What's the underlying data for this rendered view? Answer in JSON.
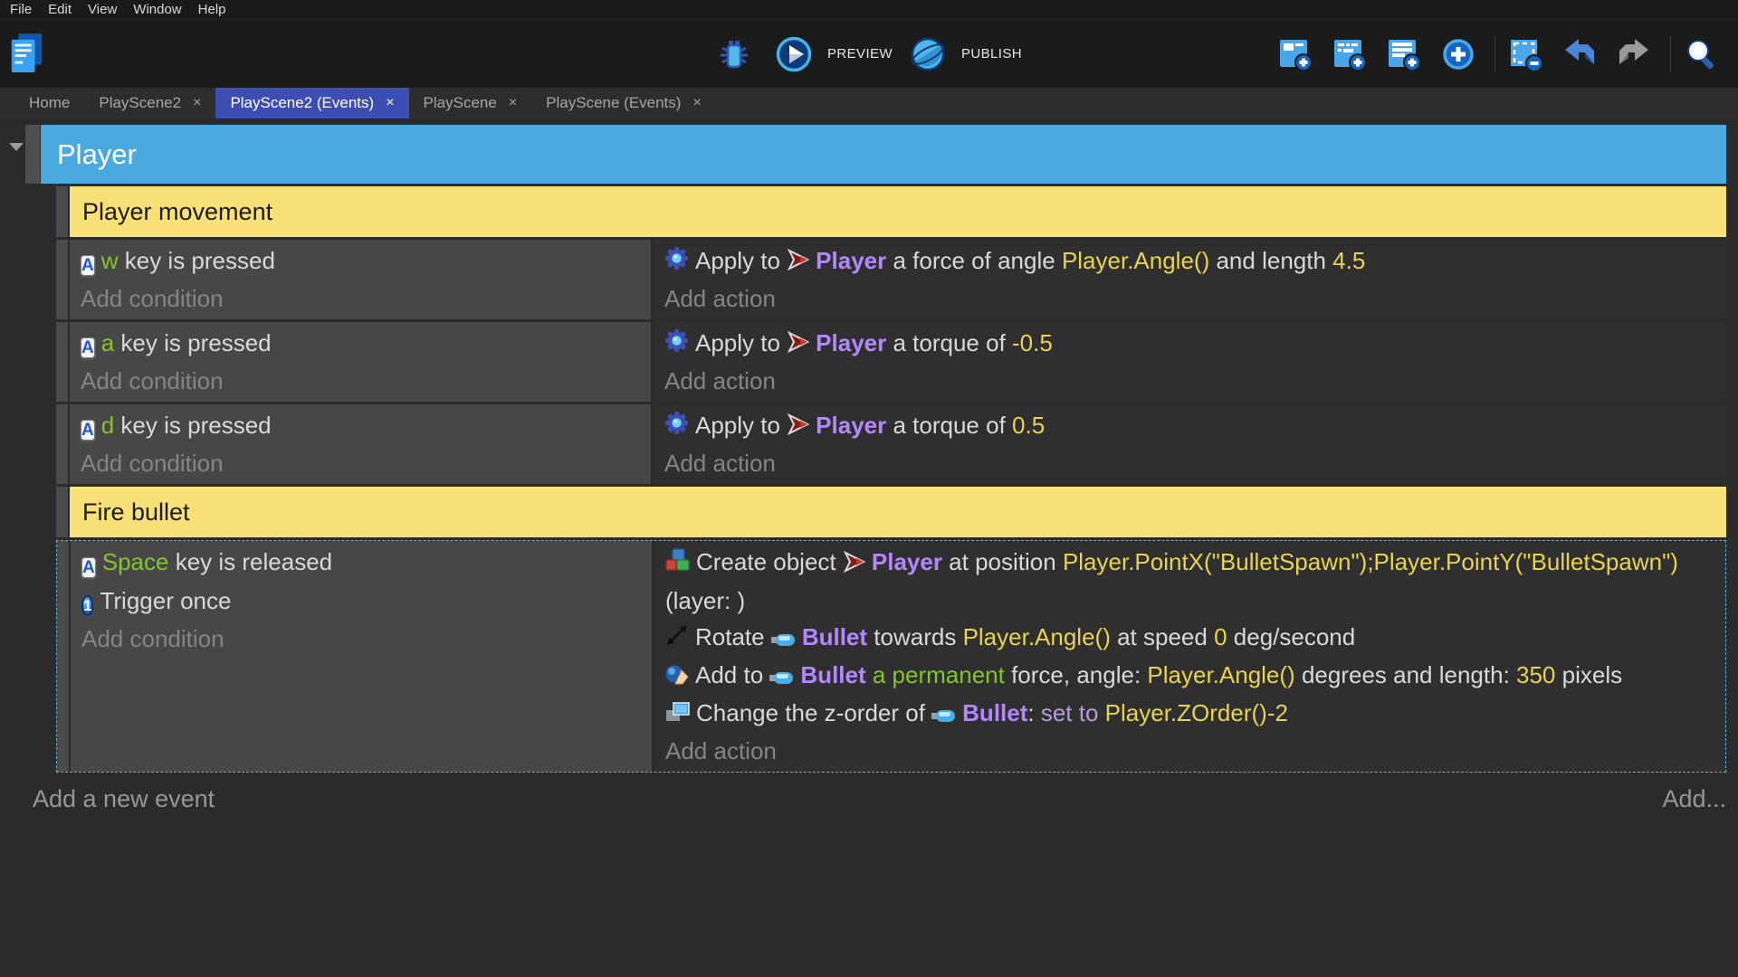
{
  "menu": {
    "items": [
      "File",
      "Edit",
      "View",
      "Window",
      "Help"
    ]
  },
  "toolbar": {
    "preview_label": "PREVIEW",
    "publish_label": "PUBLISH",
    "left_buttons": [
      {
        "name": "project-manager-button",
        "icon": "project-manager-icon"
      }
    ],
    "center_buttons": [
      {
        "name": "debug-button",
        "icon": "debug-icon"
      },
      {
        "name": "preview-button",
        "icon": "preview-icon",
        "label_path": "toolbar.preview_label"
      },
      {
        "name": "publish-button",
        "icon": "publish-icon",
        "label_path": "toolbar.publish_label"
      }
    ],
    "right_buttons": [
      {
        "name": "add-event-button",
        "icon": "add-event-icon"
      },
      {
        "name": "add-subevent-button",
        "icon": "add-subevent-icon"
      },
      {
        "name": "add-comment-button",
        "icon": "add-comment-icon"
      },
      {
        "name": "choose-event-button",
        "icon": "circle-plus-icon"
      },
      {
        "sep": true
      },
      {
        "name": "delete-selection-button",
        "icon": "delete-selection-icon"
      },
      {
        "name": "undo-button",
        "icon": "undo-icon"
      },
      {
        "name": "redo-button",
        "icon": "redo-icon"
      },
      {
        "sep": true
      },
      {
        "name": "search-button",
        "icon": "search-icon"
      }
    ]
  },
  "tabs": [
    {
      "label": "Home",
      "closable": false,
      "active": false
    },
    {
      "label": "PlayScene2",
      "closable": true,
      "active": false
    },
    {
      "label": "PlayScene2 (Events)",
      "closable": true,
      "active": true
    },
    {
      "label": "PlayScene",
      "closable": true,
      "active": false
    },
    {
      "label": "PlayScene (Events)",
      "closable": true,
      "active": false
    }
  ],
  "events_sheet": {
    "group_title": "Player",
    "add_condition_label": "Add condition",
    "add_action_label": "Add action",
    "footer": {
      "add_event_label": "Add a new event",
      "add_more_label": "Add..."
    },
    "rows": [
      {
        "type": "group",
        "label": "Player movement"
      },
      {
        "type": "event",
        "conditions": [
          [
            {
              "icon": "keyboard-icon"
            },
            {
              "t": "w",
              "c": "green"
            },
            {
              "t": " key is pressed"
            }
          ]
        ],
        "actions": [
          [
            {
              "icon": "physics-icon"
            },
            {
              "t": "Apply to "
            },
            {
              "icon": "player-object-icon"
            },
            {
              "t": "Player",
              "c": "purple"
            },
            {
              "t": " a force of angle "
            },
            {
              "t": "Player.Angle()",
              "c": "yellow"
            },
            {
              "t": " and length "
            },
            {
              "t": "4.5",
              "c": "yellow"
            }
          ]
        ]
      },
      {
        "type": "event",
        "conditions": [
          [
            {
              "icon": "keyboard-icon"
            },
            {
              "t": "a",
              "c": "green"
            },
            {
              "t": " key is pressed"
            }
          ]
        ],
        "actions": [
          [
            {
              "icon": "physics-icon"
            },
            {
              "t": "Apply to "
            },
            {
              "icon": "player-object-icon"
            },
            {
              "t": "Player",
              "c": "purple"
            },
            {
              "t": " a torque of "
            },
            {
              "t": "-0.5",
              "c": "yellow"
            }
          ]
        ]
      },
      {
        "type": "event",
        "conditions": [
          [
            {
              "icon": "keyboard-icon"
            },
            {
              "t": "d",
              "c": "green"
            },
            {
              "t": " key is pressed"
            }
          ]
        ],
        "actions": [
          [
            {
              "icon": "physics-icon"
            },
            {
              "t": "Apply to "
            },
            {
              "icon": "player-object-icon"
            },
            {
              "t": "Player",
              "c": "purple"
            },
            {
              "t": " a torque of "
            },
            {
              "t": "0.5",
              "c": "yellow"
            }
          ]
        ]
      },
      {
        "type": "group",
        "label": "Fire bullet"
      },
      {
        "type": "event",
        "selected": true,
        "conditions": [
          [
            {
              "icon": "keyboard-icon"
            },
            {
              "t": "Space",
              "c": "green"
            },
            {
              "t": " key is released"
            }
          ],
          [
            {
              "icon": "trigger-once-icon"
            },
            {
              "t": "Trigger once"
            }
          ]
        ],
        "actions": [
          [
            {
              "icon": "create-object-icon"
            },
            {
              "t": "Create object "
            },
            {
              "icon": "player-object-icon"
            },
            {
              "t": "Player",
              "c": "purple"
            },
            {
              "t": " at position "
            },
            {
              "t": "Player.PointX(\"BulletSpawn\");Player.PointY(\"BulletSpawn\")",
              "c": "yellow"
            },
            {
              "t": " (layer: )"
            }
          ],
          [
            {
              "icon": "rotate-icon"
            },
            {
              "t": "Rotate "
            },
            {
              "icon": "bullet-object-icon"
            },
            {
              "t": "Bullet",
              "c": "purple"
            },
            {
              "t": " towards "
            },
            {
              "t": "Player.Angle()",
              "c": "yellow"
            },
            {
              "t": " at speed "
            },
            {
              "t": "0",
              "c": "yellow"
            },
            {
              "t": " deg/second"
            }
          ],
          [
            {
              "icon": "force-icon"
            },
            {
              "t": "Add to "
            },
            {
              "icon": "bullet-object-icon"
            },
            {
              "t": "Bullet",
              "c": "purple"
            },
            {
              "t": " a permanent",
              "c": "green"
            },
            {
              "t": " force, angle: "
            },
            {
              "t": "Player.Angle()",
              "c": "yellow"
            },
            {
              "t": " degrees and length: "
            },
            {
              "t": "350",
              "c": "yellow"
            },
            {
              "t": " pixels"
            }
          ],
          [
            {
              "icon": "zorder-icon"
            },
            {
              "t": "Change the z-order of "
            },
            {
              "icon": "bullet-object-icon"
            },
            {
              "t": "Bullet",
              "c": "purple"
            },
            {
              "t": ": "
            },
            {
              "t": "set to ",
              "c": "lavender"
            },
            {
              "t": "Player.ZOrder()-2",
              "c": "yellow"
            }
          ]
        ]
      }
    ]
  },
  "colors": {
    "header_blue": "#4aa9de",
    "group_yellow": "#f9e178",
    "active_tab_indigo": "#3c4db3",
    "expression_yellow": "#e9d34f",
    "object_purple": "#b388ff",
    "key_green": "#85c42c",
    "operator_lavender": "#b39ddb"
  }
}
